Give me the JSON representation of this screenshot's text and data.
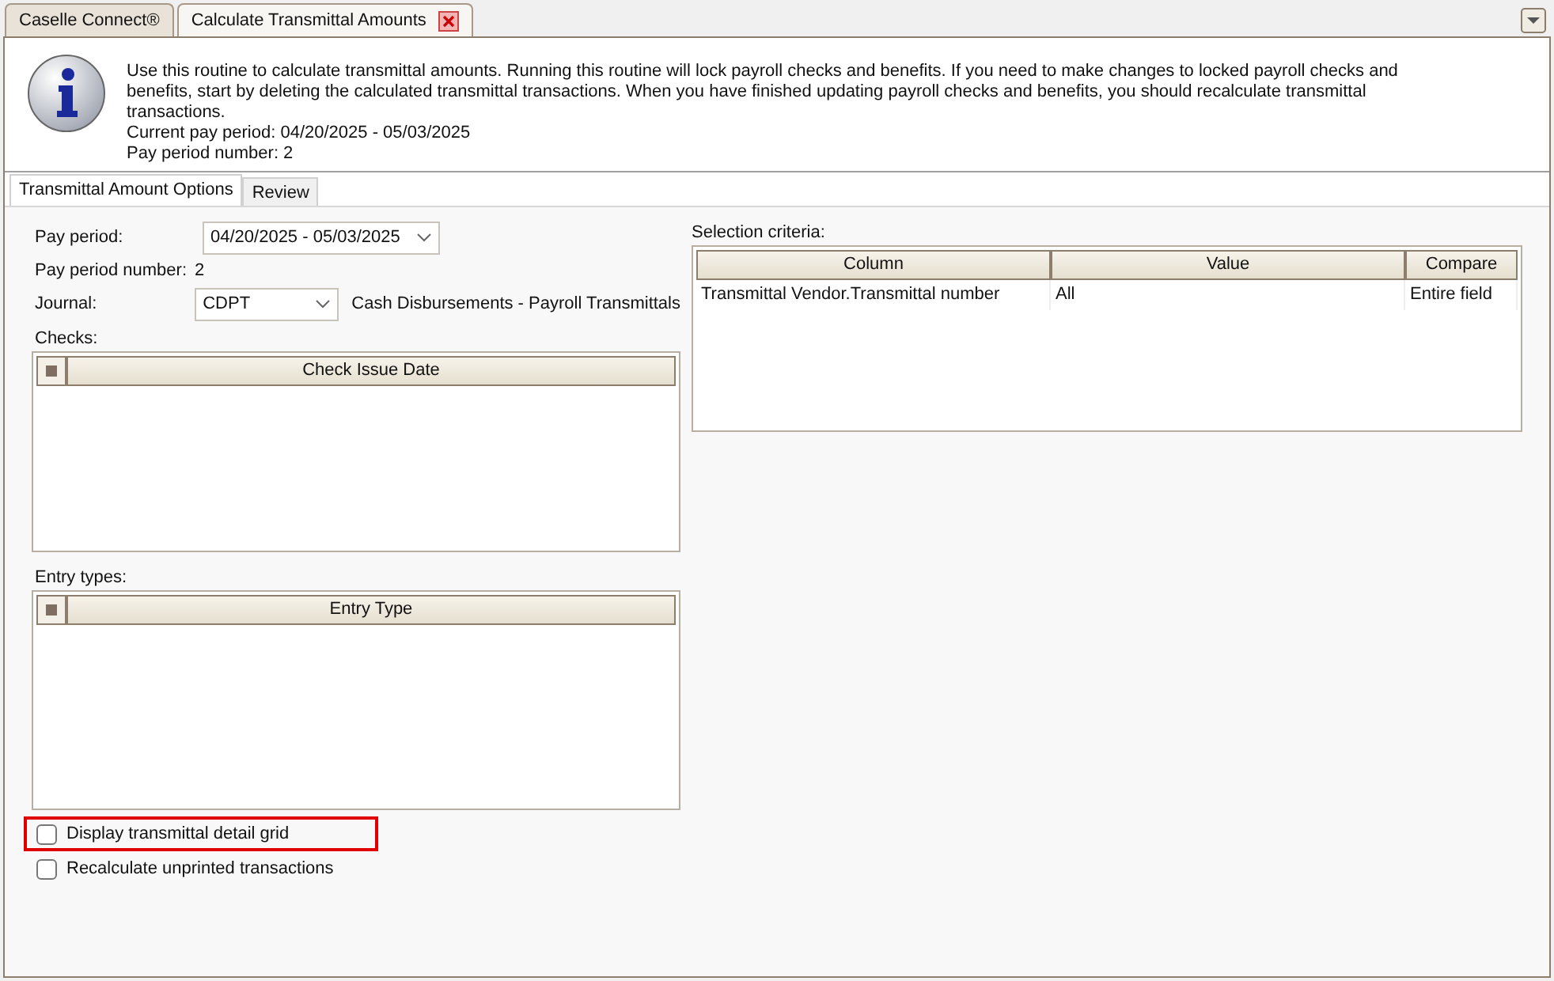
{
  "doc_tabs": [
    {
      "label": "Caselle Connect®",
      "selected": false,
      "closable": false
    },
    {
      "label": "Calculate Transmittal Amounts",
      "selected": true,
      "closable": true
    }
  ],
  "info": {
    "lines": [
      "Use this routine to calculate transmittal amounts. Running this routine will lock payroll checks and benefits. If you need to make changes to locked payroll checks and benefits, start by deleting the calculated transmittal transactions. When you have finished updating payroll checks and benefits, you should recalculate transmittal transactions.",
      "Current pay period: 04/20/2025 - 05/03/2025",
      "Pay period number: 2"
    ]
  },
  "tabs": [
    {
      "label": "Transmittal Amount Options",
      "selected": true
    },
    {
      "label": "Review",
      "selected": false
    }
  ],
  "pay_period": {
    "label": "Pay period:",
    "value": "04/20/2025 - 05/03/2025"
  },
  "pay_period_number": {
    "label": "Pay period number:",
    "value": "2"
  },
  "journal": {
    "label": "Journal:",
    "value": "CDPT",
    "description": "Cash Disbursements - Payroll Transmittals"
  },
  "checks": {
    "label": "Checks:",
    "column": "Check Issue Date",
    "indeterminate": true
  },
  "entry_types": {
    "label": "Entry types:",
    "column": "Entry Type",
    "indeterminate": true
  },
  "options": [
    {
      "label": "Display transmittal detail grid",
      "checked": false,
      "highlighted": true
    },
    {
      "label": "Recalculate unprinted transactions",
      "checked": false,
      "highlighted": false
    }
  ],
  "selection_criteria": {
    "label": "Selection criteria:",
    "columns": [
      "Column",
      "Value",
      "Compare"
    ],
    "rows": [
      [
        "Transmittal Vendor.Transmittal number",
        "All",
        "Entire field"
      ]
    ]
  }
}
